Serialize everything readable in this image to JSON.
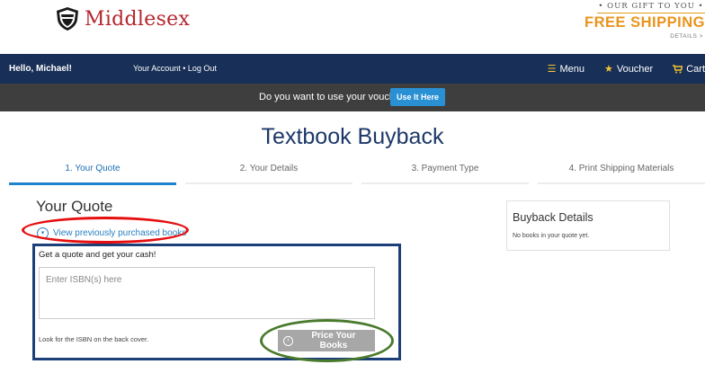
{
  "header": {
    "logo_text": "Middlesex",
    "promo_tagline": "• OUR GIFT TO YOU •",
    "promo_main": "FREE SHIPPING",
    "promo_details": "DETAILS >"
  },
  "navbar": {
    "greeting": "Hello, Michael!",
    "account_link": "Your Account",
    "separator": "•",
    "logout_link": "Log Out",
    "menu_label": "Menu",
    "voucher_label": "Voucher",
    "cart_label": "Cart"
  },
  "voucher_bar": {
    "question": "Do you want to use your voucher?",
    "button_label": "Use It Here"
  },
  "page": {
    "title": "Textbook Buyback"
  },
  "steps": [
    {
      "label": "1. Your Quote",
      "active": true
    },
    {
      "label": "2. Your Details",
      "active": false
    },
    {
      "label": "3. Payment Type",
      "active": false
    },
    {
      "label": "4. Print Shipping Materials",
      "active": false
    }
  ],
  "quote": {
    "heading": "Your Quote",
    "view_previous": "View previously purchased books",
    "prompt": "Get a quote and get your cash!",
    "isbn_placeholder": "Enter ISBN(s) here",
    "isbn_hint": "Look for the ISBN on the back cover.",
    "price_button": "Price Your Books"
  },
  "buyback_details": {
    "title": "Buyback Details",
    "empty_message": "No books in your quote yet."
  },
  "colors": {
    "brand_red": "#b5262f",
    "navy": "#182f57",
    "promo_orange": "#e8951d",
    "accent_blue": "#2a90d4",
    "annotation_red": "#e60e0e",
    "annotation_navy": "#1c3f7a",
    "annotation_green": "#4a7a2c"
  }
}
